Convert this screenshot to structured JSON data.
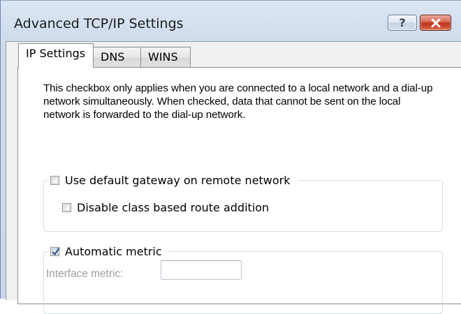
{
  "window": {
    "title": "Advanced TCP/IP Settings",
    "help_glyph": "?",
    "colors": {
      "close": "#c0381f",
      "frame": "#cfdcec",
      "panel": "#ffffff"
    }
  },
  "tabs": [
    {
      "label": "IP Settings",
      "active": true
    },
    {
      "label": "DNS",
      "active": false
    },
    {
      "label": "WINS",
      "active": false
    }
  ],
  "panel": {
    "description": "This checkbox only applies when you are connected to a local network and a dial-up network simultaneously.  When checked, data that cannot be sent on the local network is forwarded to the dial-up network.",
    "gateway_group": {
      "use_default_gateway": {
        "label": "Use default gateway on remote network",
        "checked": false
      },
      "disable_class_route": {
        "label": "Disable class based route addition",
        "checked": false
      }
    },
    "metric_group": {
      "automatic_metric": {
        "label": "Automatic metric",
        "checked": true
      },
      "interface_metric": {
        "label": "Interface metric:",
        "value": "",
        "enabled": false
      }
    }
  }
}
